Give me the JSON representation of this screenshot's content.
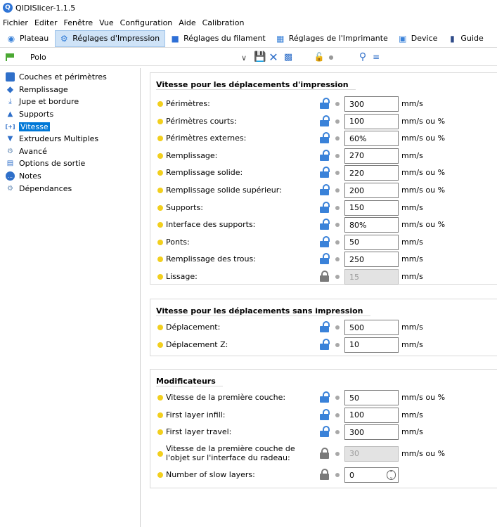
{
  "app": {
    "title": "QIDISlicer-1.1.5"
  },
  "menu": [
    "Fichier",
    "Editer",
    "Fenêtre",
    "Vue",
    "Configuration",
    "Aide",
    "Calibration"
  ],
  "tabs": [
    {
      "label": "Plateau",
      "icon": "plate-icon",
      "active": false
    },
    {
      "label": "Réglages d'Impression",
      "icon": "gear-icon",
      "active": true
    },
    {
      "label": "Réglages du filament",
      "icon": "filament-spool-icon",
      "active": false
    },
    {
      "label": "Réglages de l'Imprimante",
      "icon": "printer-icon",
      "active": false
    },
    {
      "label": "Device",
      "icon": "device-icon",
      "active": false
    },
    {
      "label": "Guide",
      "icon": "guide-icon",
      "active": false
    }
  ],
  "preset": {
    "name": "Polo"
  },
  "sidebar": [
    {
      "label": "Couches et périmètres",
      "icon": "layers-icon",
      "selected": false
    },
    {
      "label": "Remplissage",
      "icon": "infill-icon",
      "selected": false
    },
    {
      "label": "Jupe et bordure",
      "icon": "skirt-icon",
      "selected": false
    },
    {
      "label": "Supports",
      "icon": "supports-icon",
      "selected": false
    },
    {
      "label": "Vitesse",
      "icon": "speed-icon",
      "selected": true
    },
    {
      "label": "Extrudeurs Multiples",
      "icon": "extruder-icon",
      "selected": false
    },
    {
      "label": "Avancé",
      "icon": "advanced-icon",
      "selected": false
    },
    {
      "label": "Options de sortie",
      "icon": "output-icon",
      "selected": false
    },
    {
      "label": "Notes",
      "icon": "notes-icon",
      "selected": false
    },
    {
      "label": "Dépendances",
      "icon": "dependencies-icon",
      "selected": false
    }
  ],
  "groups": [
    {
      "title": "Vitesse pour les déplacements d'impression",
      "rows": [
        {
          "label": "Périmètres:",
          "value": "300",
          "unit": "mm/s",
          "locked": false,
          "disabled": false
        },
        {
          "label": "Périmètres courts:",
          "value": "100",
          "unit": "mm/s ou %",
          "locked": false,
          "disabled": false
        },
        {
          "label": "Périmètres externes:",
          "value": "60%",
          "unit": "mm/s ou %",
          "locked": false,
          "disabled": false
        },
        {
          "label": "Remplissage:",
          "value": "270",
          "unit": "mm/s",
          "locked": false,
          "disabled": false
        },
        {
          "label": "Remplissage solide:",
          "value": "220",
          "unit": "mm/s ou %",
          "locked": false,
          "disabled": false
        },
        {
          "label": "Remplissage solide supérieur:",
          "value": "200",
          "unit": "mm/s ou %",
          "locked": false,
          "disabled": false
        },
        {
          "label": "Supports:",
          "value": "150",
          "unit": "mm/s",
          "locked": false,
          "disabled": false
        },
        {
          "label": "Interface des supports:",
          "value": "80%",
          "unit": "mm/s ou %",
          "locked": false,
          "disabled": false
        },
        {
          "label": "Ponts:",
          "value": "50",
          "unit": "mm/s",
          "locked": false,
          "disabled": false
        },
        {
          "label": "Remplissage des trous:",
          "value": "250",
          "unit": "mm/s",
          "locked": false,
          "disabled": false
        },
        {
          "label": "Lissage:",
          "value": "15",
          "unit": "mm/s",
          "locked": true,
          "disabled": true
        }
      ]
    },
    {
      "title": "Vitesse pour les déplacements sans impression",
      "rows": [
        {
          "label": "Déplacement:",
          "value": "500",
          "unit": "mm/s",
          "locked": false,
          "disabled": false
        },
        {
          "label": "Déplacement Z:",
          "value": "10",
          "unit": "mm/s",
          "locked": false,
          "disabled": false
        }
      ]
    },
    {
      "title": "Modificateurs",
      "rows": [
        {
          "label": "Vitesse de la première couche:",
          "value": "50",
          "unit": "mm/s ou %",
          "locked": false,
          "disabled": false
        },
        {
          "label": "First layer infill:",
          "value": "100",
          "unit": "mm/s",
          "locked": false,
          "disabled": false
        },
        {
          "label": "First layer travel:",
          "value": "300",
          "unit": "mm/s",
          "locked": false,
          "disabled": false
        },
        {
          "label": "Vitesse de la première couche de\nl'objet sur l'interface du radeau:",
          "value": "30",
          "unit": "mm/s ou %",
          "locked": true,
          "disabled": true
        },
        {
          "label": "Number of slow layers:",
          "value": "0",
          "unit": "",
          "locked": true,
          "disabled": false,
          "spin": true
        }
      ]
    }
  ]
}
